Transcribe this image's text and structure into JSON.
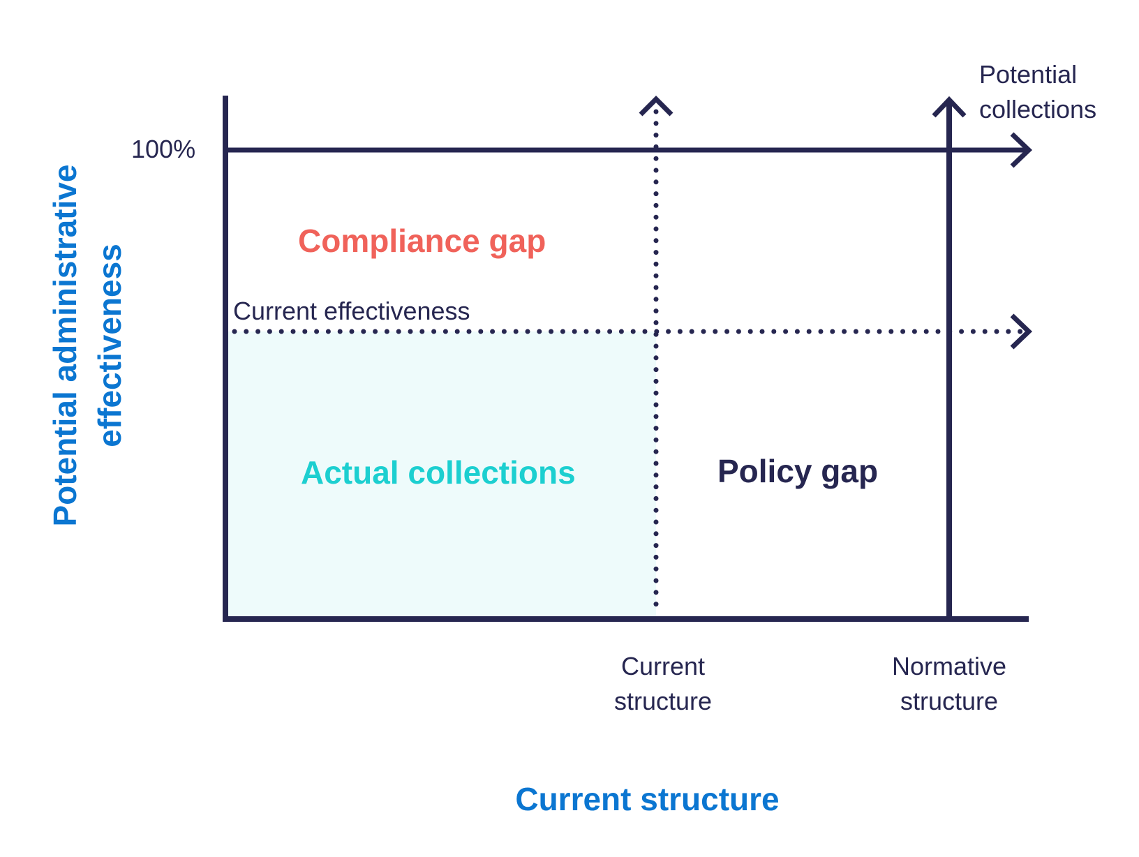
{
  "colors": {
    "ink": "#262650",
    "compliance": "#f0625a",
    "actual": "#1ccfd0",
    "actual_fill": "#eefbfb",
    "axis_title": "#0b76d1"
  },
  "labels": {
    "top_right": [
      "Potential",
      "collections"
    ],
    "hundred_percent": "100%",
    "compliance_gap": "Compliance gap",
    "current_effectiveness": "Current effectiveness",
    "actual_collections": "Actual collections",
    "policy_gap": "Policy gap",
    "current_structure_tick": [
      "Current",
      "structure"
    ],
    "normative_structure_tick": [
      "Normative",
      "structure"
    ],
    "x_axis_title": "Current structure",
    "y_axis_title": [
      "Potential administrative",
      "effectiveness"
    ]
  }
}
